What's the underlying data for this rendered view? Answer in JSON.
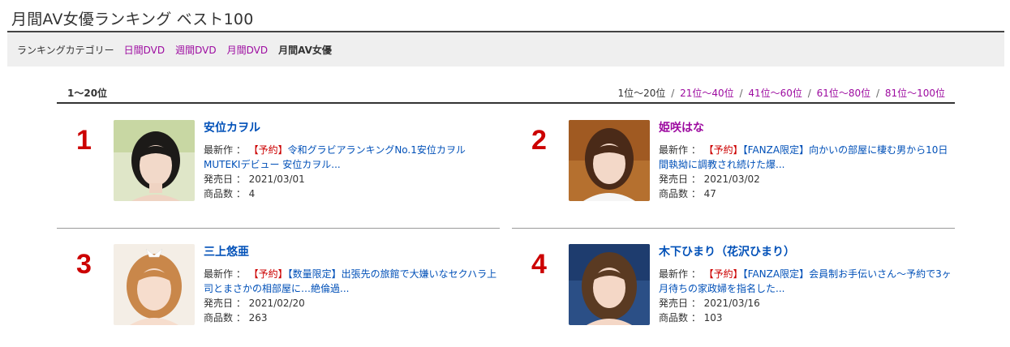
{
  "page": {
    "title": "月間AV女優ランキング ベスト100"
  },
  "categories": {
    "label": "ランキングカテゴリー",
    "links": [
      "日間DVD",
      "週間DVD",
      "月間DVD"
    ],
    "current": "月間AV女優"
  },
  "range": {
    "current_label": "1〜20位",
    "nav_current": "1位〜20位",
    "nav_links": [
      "21位〜40位",
      "41位〜60位",
      "61位〜80位",
      "81位〜100位"
    ],
    "separator": "/"
  },
  "labels": {
    "latest": "最新作 ：",
    "release": "発売日 ：",
    "count": "商品数 ："
  },
  "actresses": [
    {
      "rank": "1",
      "name": "安位カヲル",
      "tag": "【予約】",
      "work": "令和グラビアランキングNo.1安位カヲルMUTEKIデビュー 安位カヲル...",
      "release": "2021/03/01",
      "count": "4"
    },
    {
      "rank": "2",
      "name": "姫咲はな",
      "tag": "【予約】",
      "work": "【FANZA限定】向かいの部屋に棲む男から10日間執拗に調教され続けた爆...",
      "release": "2021/03/02",
      "count": "47"
    },
    {
      "rank": "3",
      "name": "三上悠亜",
      "tag": "【予約】",
      "work": "【数量限定】出張先の旅館で大嫌いなセクハラ上司とまさかの相部屋に…絶倫過...",
      "release": "2021/02/20",
      "count": "263"
    },
    {
      "rank": "4",
      "name": "木下ひまり（花沢ひまり）",
      "tag": "【予約】",
      "work": "【FANZA限定】会員制お手伝いさん〜予約で3ヶ月待ちの家政婦を指名した...",
      "release": "2021/03/16",
      "count": "103"
    }
  ],
  "colors": {
    "link": "#0050b8",
    "visited": "#9d0ba0",
    "rank": "#cc0000",
    "tag": "#cc0000"
  }
}
